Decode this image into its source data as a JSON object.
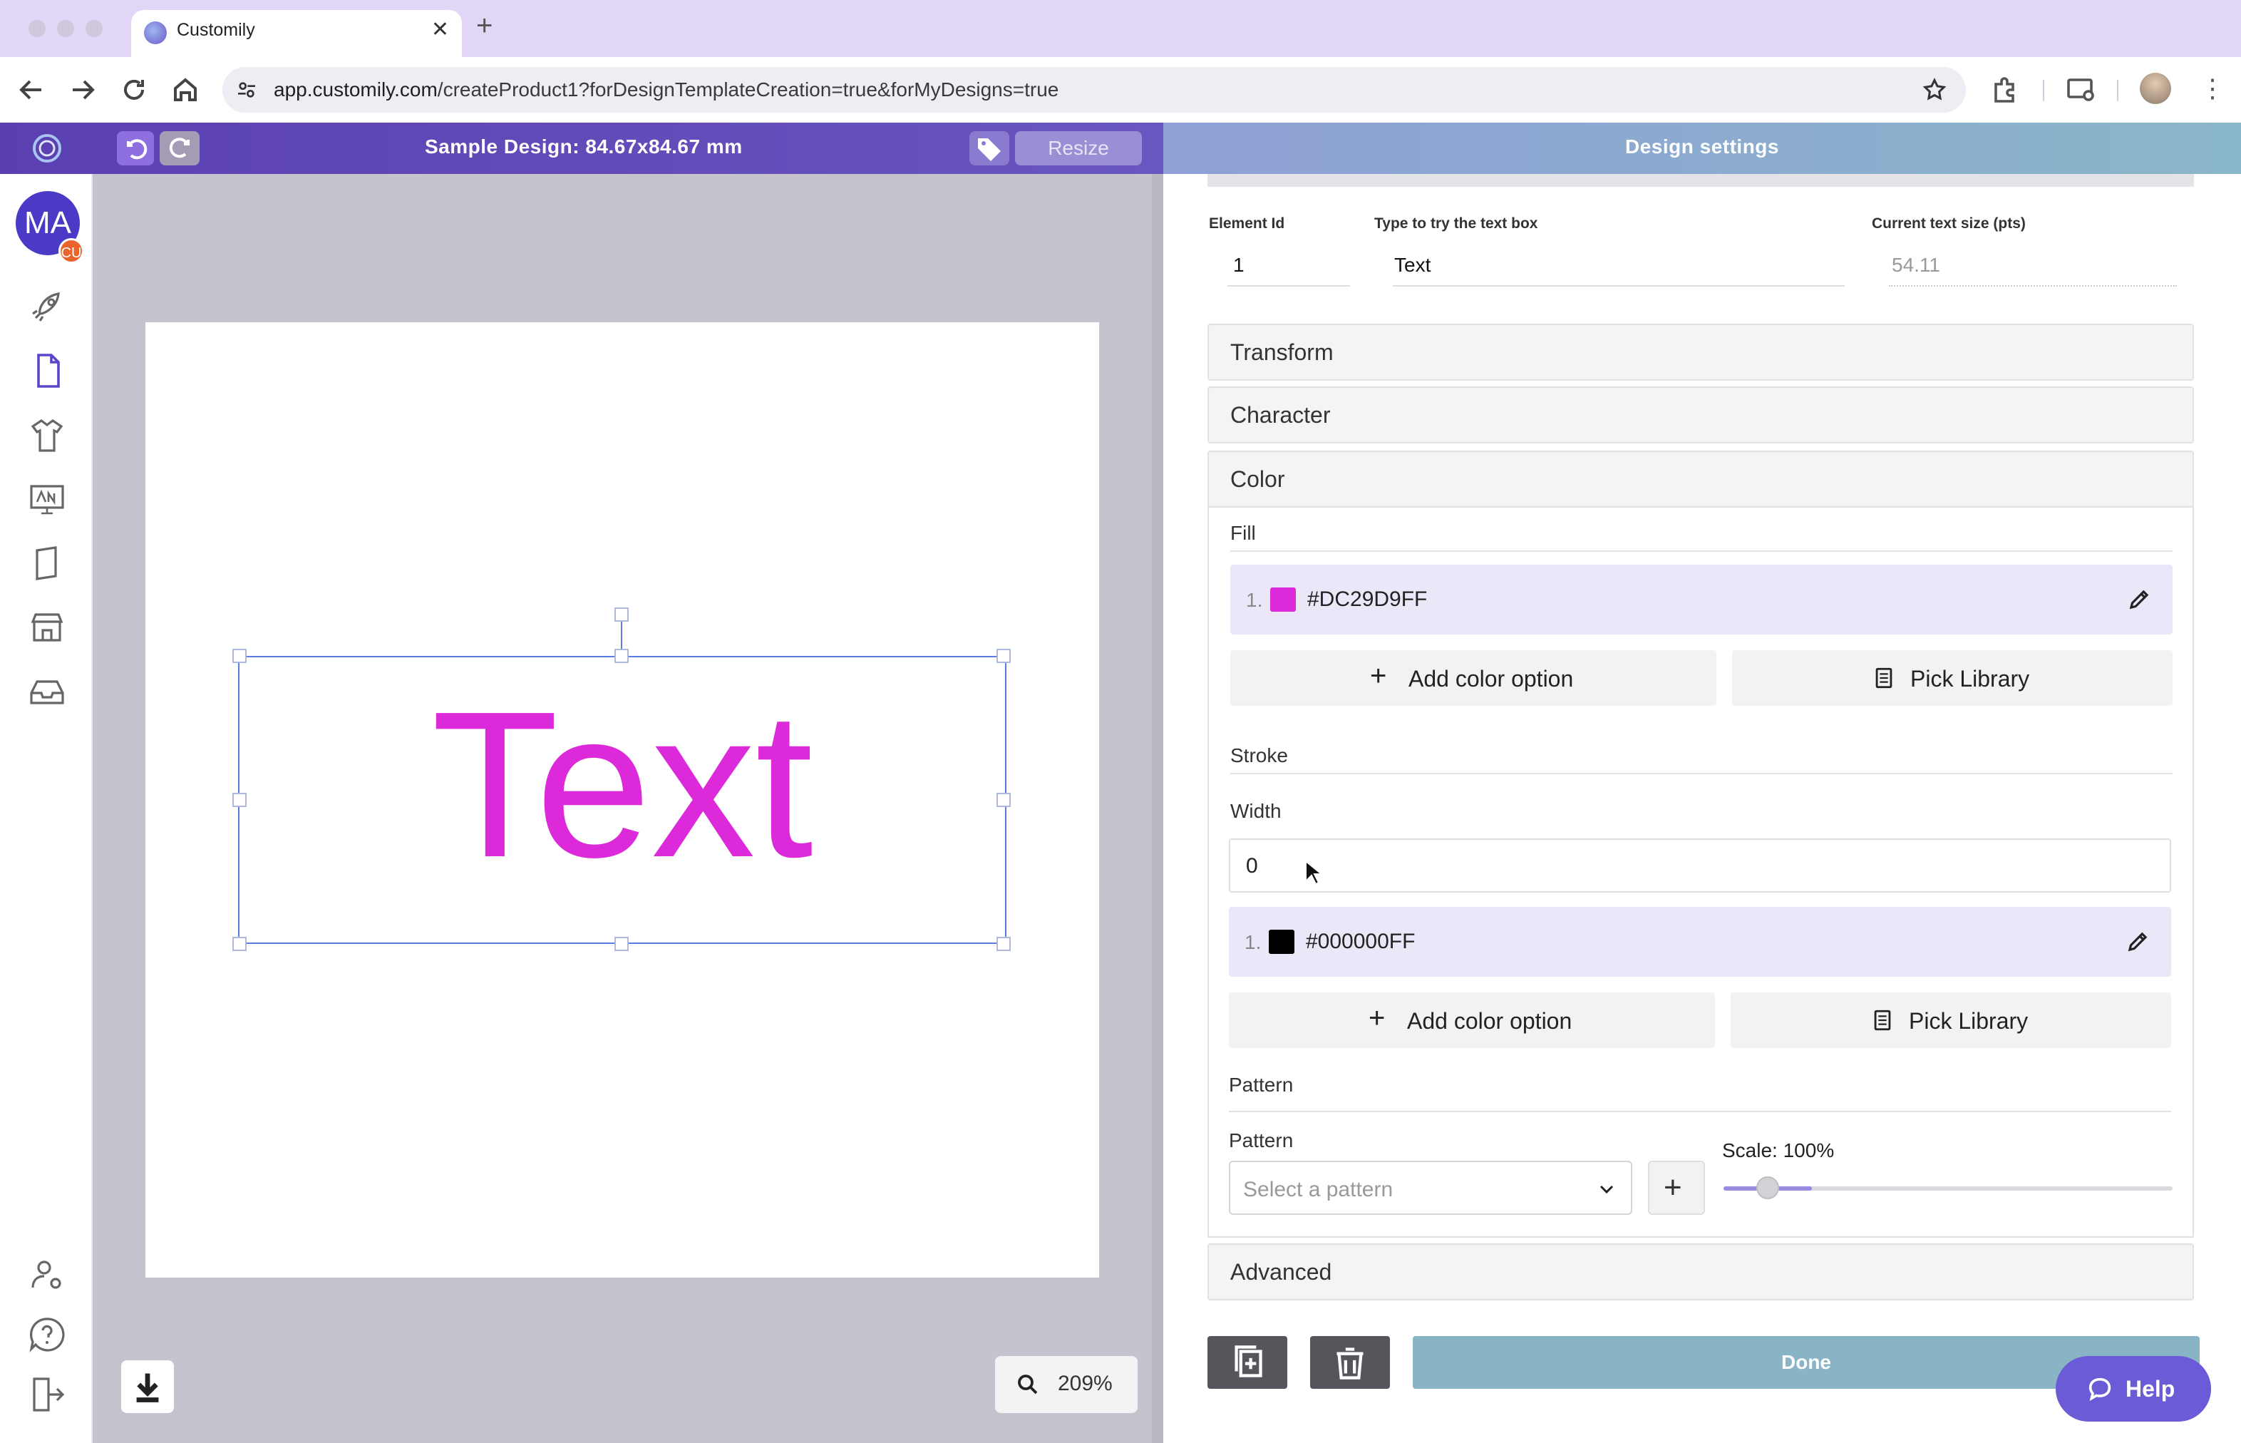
{
  "browser": {
    "tab_title": "Customily",
    "url_domain": "app.customily.com",
    "url_path": "/createProduct1?forDesignTemplateCreation=true&forMyDesigns=true"
  },
  "header": {
    "design_title": "Sample Design: 84.67x84.67 mm",
    "resize_label": "Resize",
    "settings_title": "Design settings",
    "brand_color": "#5a3fb0"
  },
  "sidebar": {
    "avatar_initials": "MA",
    "avatar_badge": "CU",
    "items": [
      "rocket-icon",
      "document-icon",
      "tshirt-icon",
      "monitor-icon",
      "book-icon",
      "store-icon",
      "inbox-icon"
    ],
    "bottom_items": [
      "user-settings-icon",
      "help-circle-icon",
      "logout-icon"
    ]
  },
  "canvas": {
    "text": "Text",
    "text_color": "#DC29D9",
    "zoom": "209%"
  },
  "panel": {
    "element_id_label": "Element Id",
    "element_id_value": "1",
    "try_text_label": "Type to try the text box",
    "try_text_value": "Text",
    "text_size_label": "Current text size (pts)",
    "text_size_value": "54.11",
    "sections": {
      "transform": "Transform",
      "character": "Character",
      "color": "Color",
      "advanced": "Advanced"
    },
    "fill": {
      "title": "Fill",
      "colors": [
        {
          "index": "1.",
          "hex": "#DC29D9FF",
          "swatch": "#DC29D9"
        }
      ],
      "add_label": "Add color option",
      "pick_label": "Pick Library"
    },
    "stroke": {
      "title": "Stroke",
      "width_label": "Width",
      "width_value": "0",
      "colors": [
        {
          "index": "1.",
          "hex": "#000000FF",
          "swatch": "#000000"
        }
      ],
      "add_label": "Add color option",
      "pick_label": "Pick Library"
    },
    "pattern": {
      "title": "Pattern",
      "field_label": "Pattern",
      "placeholder": "Select a pattern",
      "scale_label": "Scale: 100%",
      "scale_level": 0.2
    },
    "done_label": "Done",
    "help_label": "Help"
  }
}
